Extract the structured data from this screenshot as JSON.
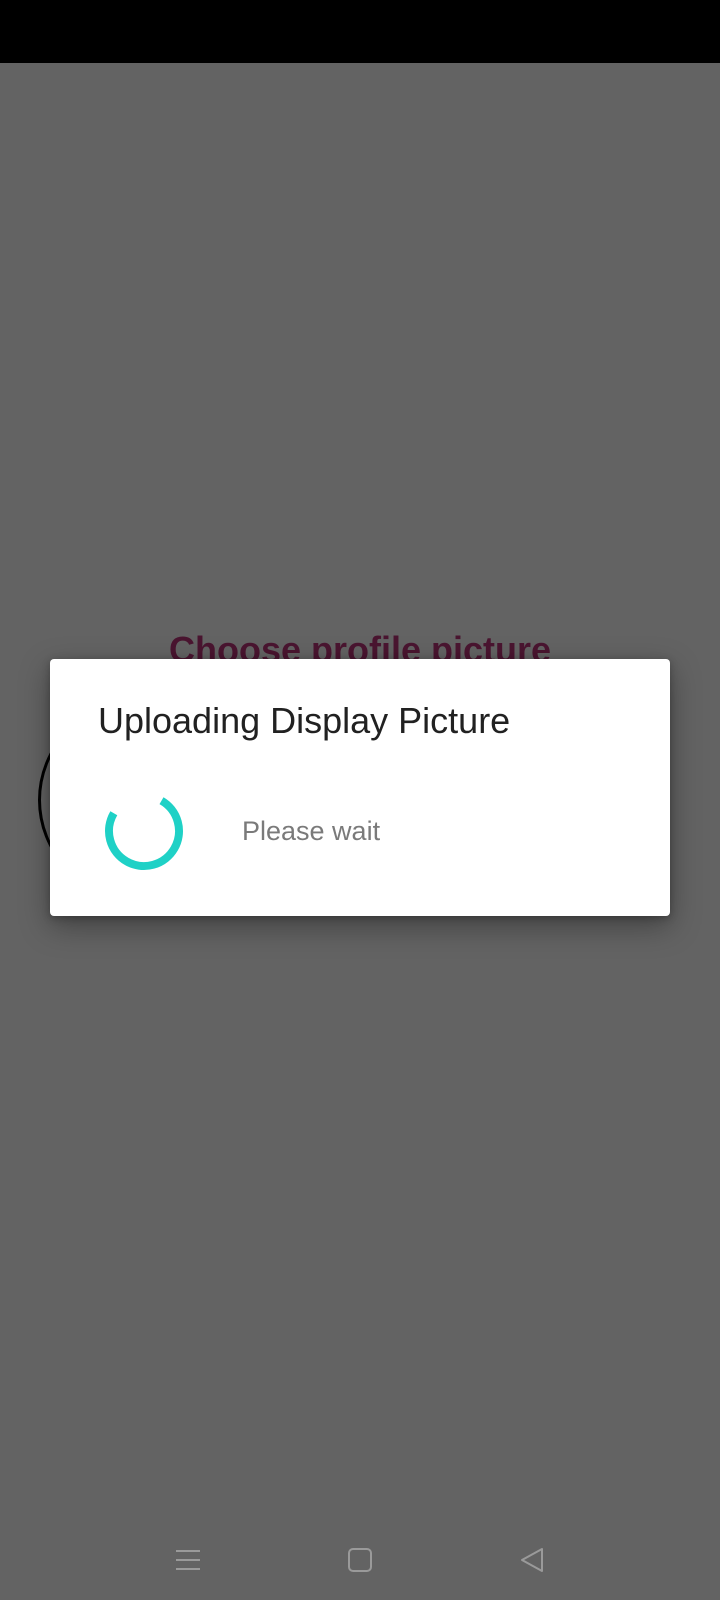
{
  "background": {
    "title": "Choose profile picture"
  },
  "dialog": {
    "title": "Uploading Display Picture",
    "message": "Please wait",
    "spinner_color": "#1fd1c6"
  },
  "navigation": {
    "items": [
      {
        "icon": "menu-icon"
      },
      {
        "icon": "home-square-icon"
      },
      {
        "icon": "back-triangle-icon"
      }
    ]
  }
}
